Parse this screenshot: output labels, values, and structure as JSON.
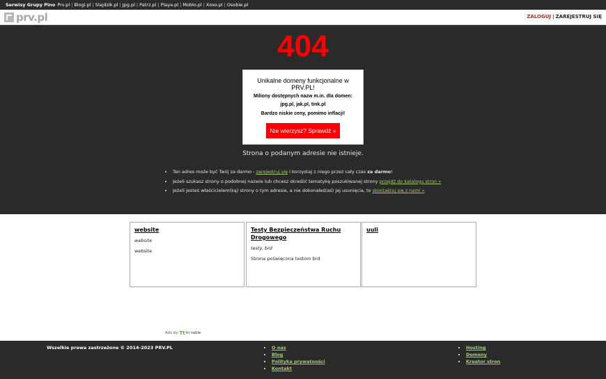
{
  "network_bar": {
    "brand": "Serwisy Grupy Pino",
    "links": [
      "Prv.pl",
      "Blogi.pl",
      "Slajdzik.pl",
      "Jpg.pl",
      "Patrz.pl",
      "Playa.pl",
      "Moblo.pl",
      "Xoxo.pl",
      "Osobie.pl"
    ]
  },
  "header": {
    "logo_text": "prv.pl",
    "login": "ZALOGUJ",
    "separator": "|",
    "register": "ZAREJESTRUJ SIĘ"
  },
  "hero": {
    "code": "404",
    "promo": {
      "title": "Unikalne domeny funkcjonalne w PRV.PL!",
      "line1": "Miliony dostępnych nazw m.in. dla domen:",
      "line2": "jpg.pl, jak.pl, tink.pl",
      "line3": "Bardzo niskie ceny, pomimo inflacji!",
      "cta": "Nie wierzysz? Sprawdź »"
    },
    "message": "Strona o podanym adresie nie istnieje.",
    "tips": [
      {
        "pre": "Ten adres może być Twój za darmo - ",
        "link": "zarejestruj się",
        "mid": " i korzystaj z niego przez cały czas ",
        "bold": "za darmo",
        "post": "!"
      },
      {
        "pre": "Jeżeli szukasz strony o podobnej nazwie lub chcesz określić tematykę poszukiwanej strony ",
        "link": "przejdź do katalogu stron »"
      },
      {
        "pre": "Jeżeli jesteś właścicielem(ką) strony o tym adresie, a nie dokonałeś(aś) jej usunięcia, to ",
        "link": "skontaktuj się z nami »"
      }
    ]
  },
  "cards": [
    {
      "title": "website",
      "tags": "website",
      "desc": "website"
    },
    {
      "title": "Testy Bezpieczeństwa Ruchu Drogowego",
      "tags": "testy, brd",
      "desc": "Strona poświęcona testom brd"
    },
    {
      "title": "uuli",
      "tags": "",
      "desc": ""
    }
  ],
  "ads": {
    "label": "Ads by",
    "brand_mark": "Tt",
    "brand": "tri-table"
  },
  "footer": {
    "copyright": "Wszelkie prawa zastrzeżone © 2014-2023 PRV.PL",
    "col1": [
      "O nas",
      "Blog",
      "Polityka prywatności",
      "Kontakt"
    ],
    "col2": [
      "Hosting",
      "Domeny",
      "Kreator stron"
    ]
  },
  "colors": {
    "accent_red": "#ff0000",
    "link_green": "#9fd16a",
    "dark_bg": "#2a2a2a"
  }
}
